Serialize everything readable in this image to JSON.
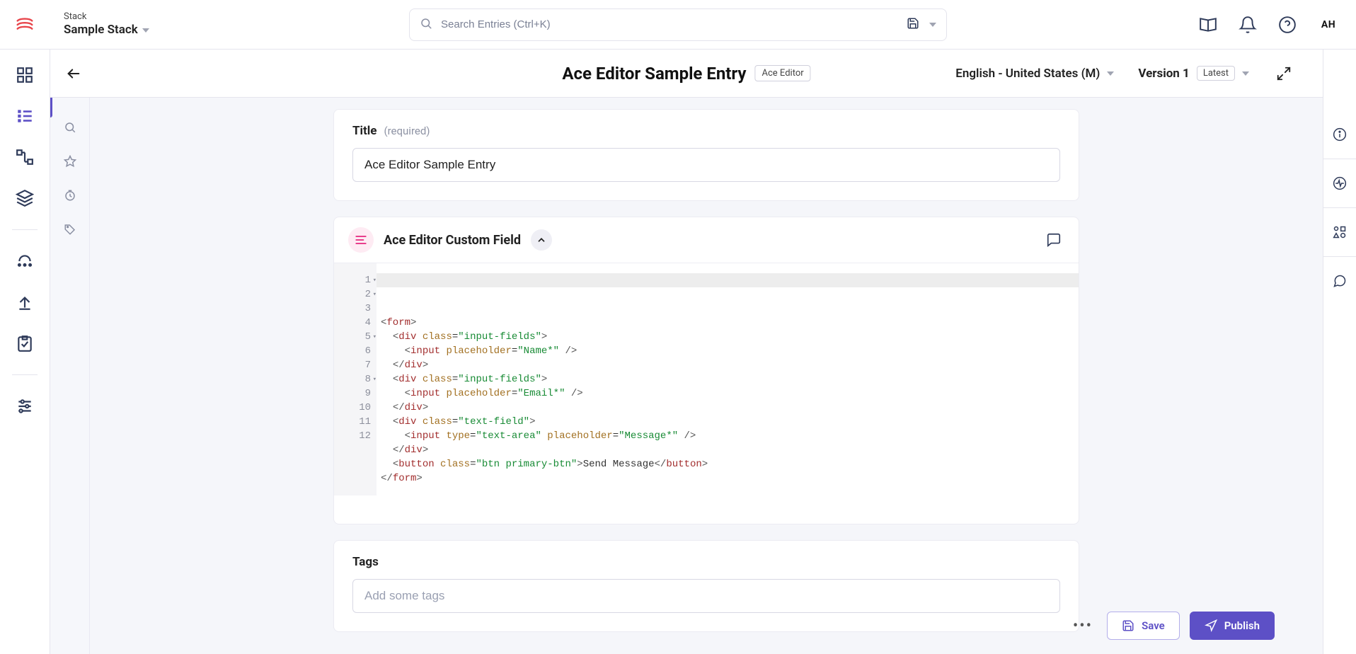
{
  "topbar": {
    "stack_label": "Stack",
    "stack_name": "Sample Stack",
    "search_placeholder": "Search Entries (Ctrl+K)",
    "user_initials": "AH"
  },
  "subheader": {
    "title": "Ace Editor Sample Entry",
    "content_type": "Ace Editor",
    "locale": "English - United States (M)",
    "version_label": "Version 1",
    "version_badge": "Latest"
  },
  "form": {
    "title_label": "Title",
    "title_hint": "(required)",
    "title_value": "Ace Editor Sample Entry",
    "ace_label": "Ace Editor Custom Field",
    "tags_label": "Tags",
    "tags_placeholder": "Add some tags"
  },
  "code_lines": [
    {
      "n": "1",
      "fold": true,
      "html": "<span class='tok-punct'>&lt;</span><span class='tok-name'>form</span><span class='tok-punct'>&gt;</span>"
    },
    {
      "n": "2",
      "fold": true,
      "html": "  <span class='tok-punct'>&lt;</span><span class='tok-name'>div</span> <span class='tok-attr'>class</span>=<span class='tok-str'>\"input-fields\"</span><span class='tok-punct'>&gt;</span>"
    },
    {
      "n": "3",
      "fold": false,
      "html": "    <span class='tok-punct'>&lt;</span><span class='tok-name'>input</span> <span class='tok-attr'>placeholder</span>=<span class='tok-str'>\"Name*\"</span> <span class='tok-punct'>/&gt;</span>"
    },
    {
      "n": "4",
      "fold": false,
      "html": "  <span class='tok-punct'>&lt;/</span><span class='tok-name'>div</span><span class='tok-punct'>&gt;</span>"
    },
    {
      "n": "5",
      "fold": true,
      "html": "  <span class='tok-punct'>&lt;</span><span class='tok-name'>div</span> <span class='tok-attr'>class</span>=<span class='tok-str'>\"input-fields\"</span><span class='tok-punct'>&gt;</span>"
    },
    {
      "n": "6",
      "fold": false,
      "html": "    <span class='tok-punct'>&lt;</span><span class='tok-name'>input</span> <span class='tok-attr'>placeholder</span>=<span class='tok-str'>\"Email*\"</span> <span class='tok-punct'>/&gt;</span>"
    },
    {
      "n": "7",
      "fold": false,
      "html": "  <span class='tok-punct'>&lt;/</span><span class='tok-name'>div</span><span class='tok-punct'>&gt;</span>"
    },
    {
      "n": "8",
      "fold": true,
      "html": "  <span class='tok-punct'>&lt;</span><span class='tok-name'>div</span> <span class='tok-attr'>class</span>=<span class='tok-str'>\"text-field\"</span><span class='tok-punct'>&gt;</span>"
    },
    {
      "n": "9",
      "fold": false,
      "html": "    <span class='tok-punct'>&lt;</span><span class='tok-name'>input</span> <span class='tok-attr'>type</span>=<span class='tok-str'>\"text-area\"</span> <span class='tok-attr'>placeholder</span>=<span class='tok-str'>\"Message*\"</span> <span class='tok-punct'>/&gt;</span>"
    },
    {
      "n": "10",
      "fold": false,
      "html": "  <span class='tok-punct'>&lt;/</span><span class='tok-name'>div</span><span class='tok-punct'>&gt;</span>"
    },
    {
      "n": "11",
      "fold": false,
      "html": "  <span class='tok-punct'>&lt;</span><span class='tok-name'>button</span> <span class='tok-attr'>class</span>=<span class='tok-str'>\"btn primary-btn\"</span><span class='tok-punct'>&gt;</span><span class='tok-text'>Send Message</span><span class='tok-punct'>&lt;/</span><span class='tok-name'>button</span><span class='tok-punct'>&gt;</span>"
    },
    {
      "n": "12",
      "fold": false,
      "html": "<span class='tok-punct'>&lt;/</span><span class='tok-name'>form</span><span class='tok-punct'>&gt;</span>"
    }
  ],
  "actions": {
    "save": "Save",
    "publish": "Publish"
  }
}
